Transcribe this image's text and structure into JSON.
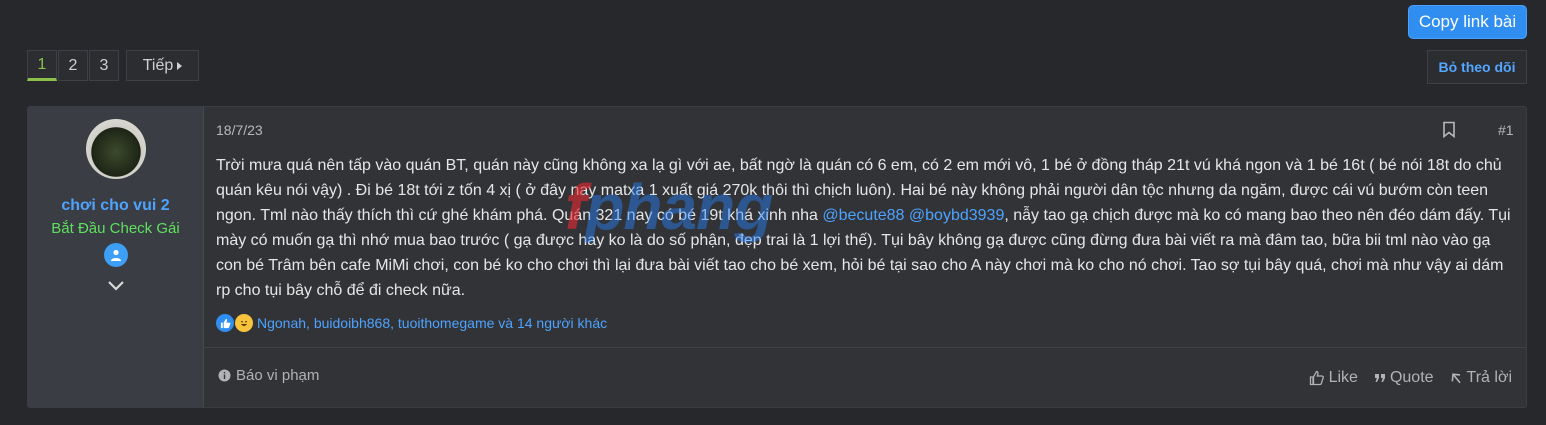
{
  "header": {
    "copy_link_label": "Copy link bài",
    "unfollow_label": "Bỏ theo dõi"
  },
  "pagination": {
    "pages": [
      "1",
      "2",
      "3"
    ],
    "active_page": "1",
    "next_label": "Tiếp"
  },
  "post": {
    "author": {
      "name": "chơi cho vui 2",
      "title": "Bắt Đầu Check Gái"
    },
    "date": "18/7/23",
    "number": "#1",
    "content": {
      "part1": "Trời mưa quá nên tấp vào quán BT, quán này cũng không xa lạ gì với ae, bất ngờ là quán có 6 em, có 2 em mới vô, 1 bé ở đồng tháp 21t vú khá ngon và 1 bé 16t ( bé nói 18t do chủ quán kêu nói vậy) . Đi bé 18t tới z tốn 4 xị ( ở đây nay matxa 1 xuất giá 270k thôi thì chịch luôn). Hai bé này không phải người dân tộc nhưng da ngăm, được cái vú bướm còn teen ngon. Tml nào thấy thích thì cứ ghé khám phá. Quán 321 nay có bé 19t khá xinh nha ",
      "mention1": "@becute88",
      "mention2": "@boybd3939",
      "part2": ", nẫy tao gạ chịch được mà ko có mang bao theo nên đéo dám đấy. Tụi mày có muốn gạ thì nhớ mua bao trước ( gạ được hay ko là do số phận, đẹp trai là 1 lợi thế). Tụi bây không gạ được cũng đừng đưa bài viết ra mà đâm tao, bữa bii tml nào vào gạ con bé Trâm bên cafe MiMi chơi, con bé ko cho chơi thì lại đưa bài viết tao cho bé xem, hỏi bé tại sao cho A này chơi mà ko cho nó chơi. Tao sợ tụi bây quá, chơi mà như vậy ai dám rp cho tụi bây chỗ để đi check nữa."
    },
    "reactions_text": "Ngonah, buidoibh868, tuoithomegame và 14 người khác",
    "report_label": "Báo vi phạm",
    "actions": {
      "like": "Like",
      "quote": "Quote",
      "reply": "Trả lời"
    }
  },
  "watermark": {
    "part1": "f",
    "part2": "phang"
  },
  "colors": {
    "accent": "#2f8ef0",
    "username": "#4ea3ff",
    "user_title": "#5ee05e",
    "active_page": "#8cc04a"
  }
}
